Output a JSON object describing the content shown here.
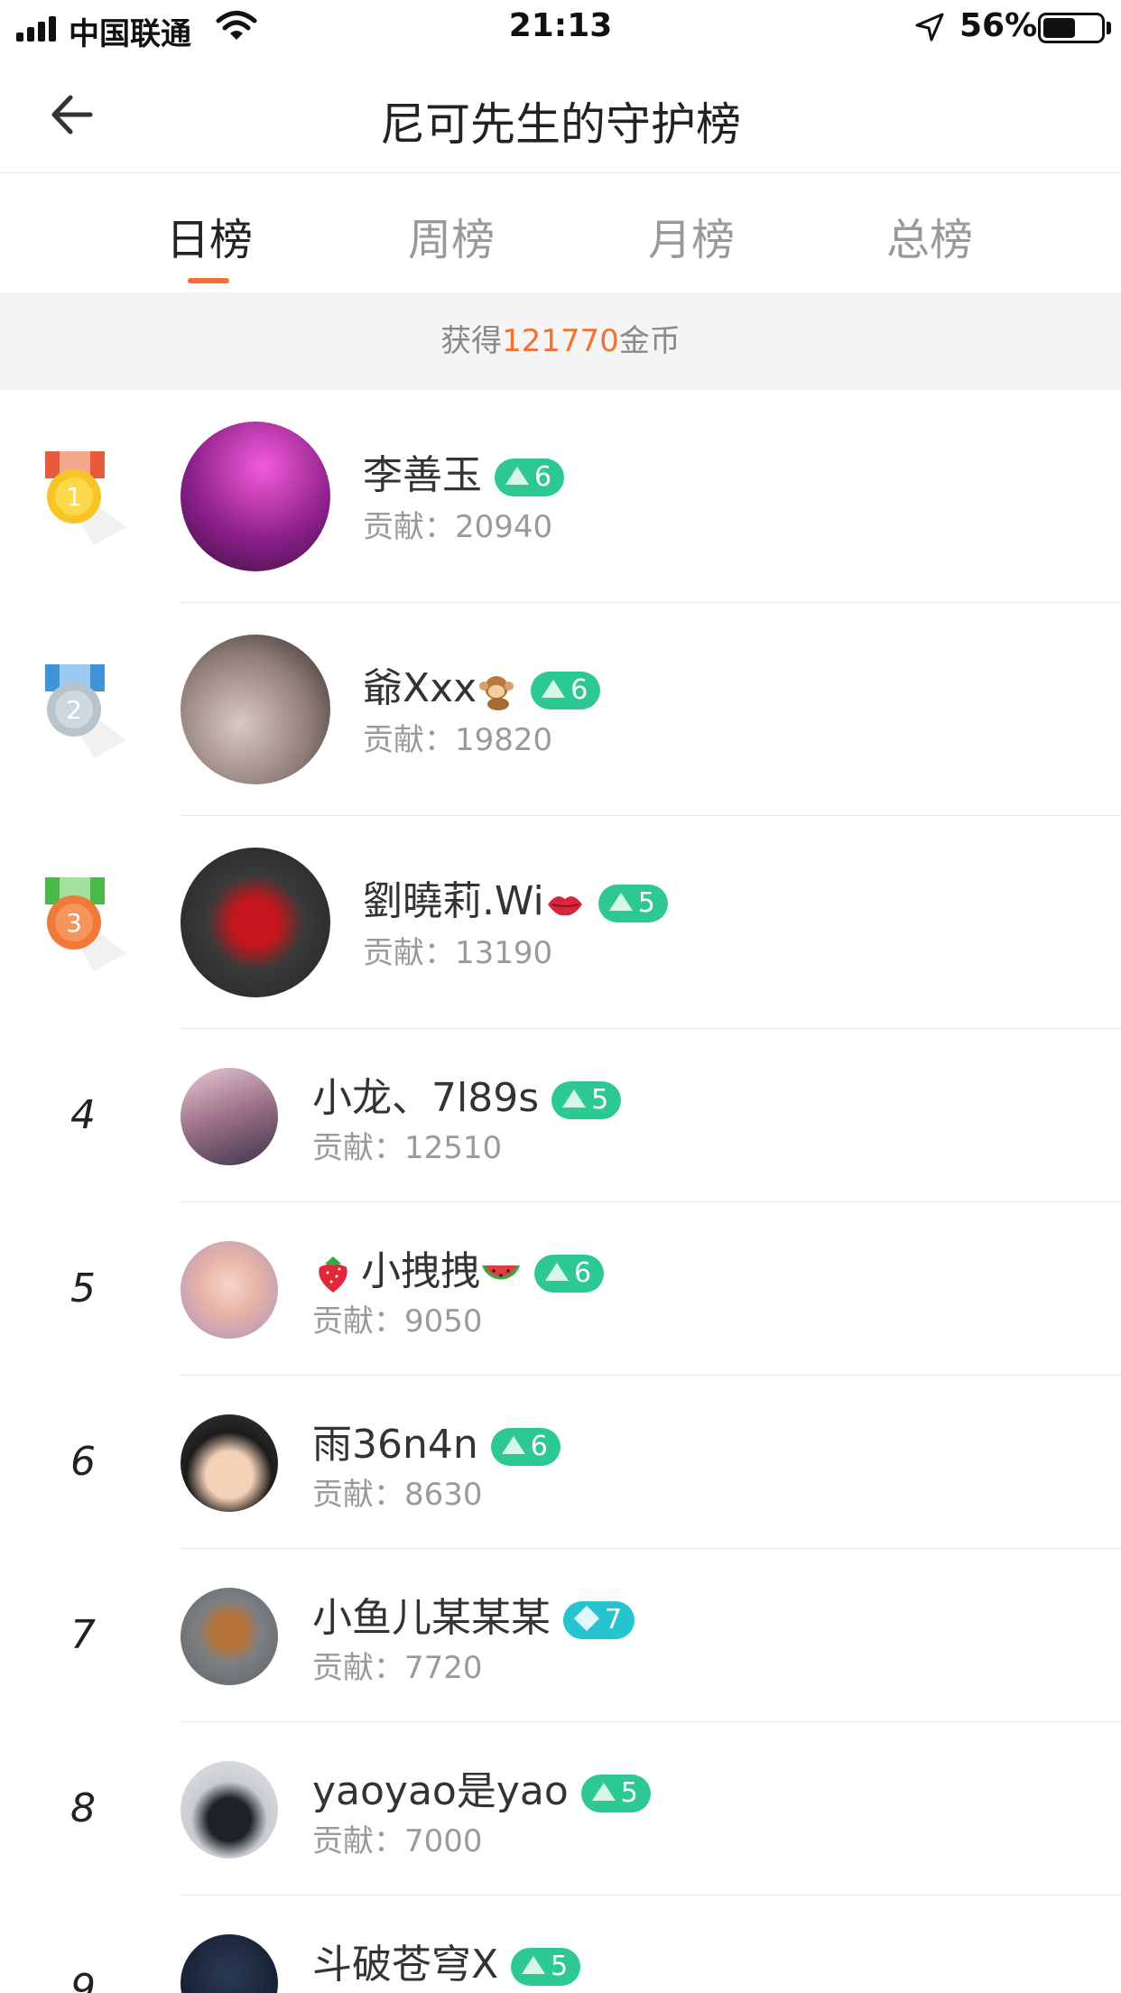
{
  "status_bar": {
    "carrier": "中国联通",
    "time": "21:13",
    "battery_pct": "56%",
    "battery_level": 0.56
  },
  "nav": {
    "title": "尼可先生的守护榜",
    "back_icon": "arrow-left-icon"
  },
  "tabs": [
    {
      "label": "日榜",
      "active": true
    },
    {
      "label": "周榜",
      "active": false
    },
    {
      "label": "月榜",
      "active": false
    },
    {
      "label": "总榜",
      "active": false
    }
  ],
  "coins": {
    "prefix": "获得",
    "amount": "121770",
    "suffix": "金币"
  },
  "colors": {
    "accent": "#f07234",
    "level_badge": "#2ec992",
    "diamond_badge": "#27c3cf"
  },
  "contrib_label": "贡献：",
  "ranking": [
    {
      "rank": "1",
      "name": "李善玉",
      "level": "6",
      "badge": "green",
      "contrib": "20940"
    },
    {
      "rank": "2",
      "name": "爺Xxx",
      "name_emoji": "monkey-icon",
      "level": "6",
      "badge": "green",
      "contrib": "19820"
    },
    {
      "rank": "3",
      "name": "劉曉莉.Wi",
      "name_emoji": "lips-icon",
      "level": "5",
      "badge": "green",
      "contrib": "13190"
    },
    {
      "rank": "4",
      "name": "小龙、7l89s",
      "level": "5",
      "badge": "green",
      "contrib": "12510"
    },
    {
      "rank": "5",
      "name": "小拽拽",
      "name_emoji_before": "strawberry-icon",
      "name_emoji": "watermelon-icon",
      "level": "6",
      "badge": "green",
      "contrib": "9050"
    },
    {
      "rank": "6",
      "name": "雨36n4n",
      "level": "6",
      "badge": "green",
      "contrib": "8630"
    },
    {
      "rank": "7",
      "name": "小鱼儿某某某",
      "level": "7",
      "badge": "diamond",
      "contrib": "7720"
    },
    {
      "rank": "8",
      "name": "yaoyao是yao",
      "level": "5",
      "badge": "green",
      "contrib": "7000"
    },
    {
      "rank": "9",
      "name": "斗破苍穹X",
      "level": "5",
      "badge": "green",
      "contrib": ""
    }
  ]
}
